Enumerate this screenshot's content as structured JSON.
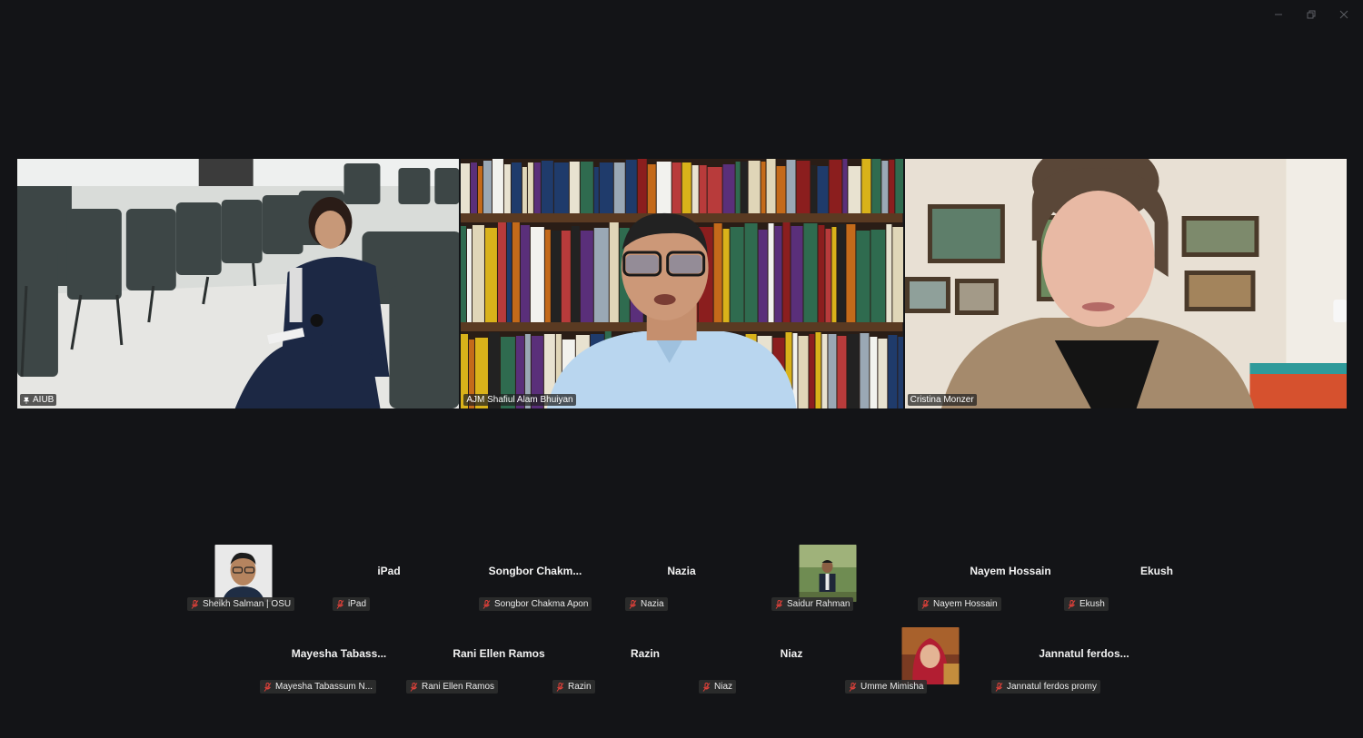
{
  "window": {
    "controls": {
      "minimize": "minimize-icon",
      "restore": "restore-icon",
      "close": "close-icon"
    }
  },
  "videos": [
    {
      "name": "AIUB",
      "active": true,
      "pinned": true
    },
    {
      "name": "AJM Shafiul Alam Bhuiyan",
      "active": false,
      "pinned": false
    },
    {
      "name": "Cristina Monzer",
      "active": false,
      "pinned": false
    }
  ],
  "participants": {
    "row1": [
      {
        "display": "",
        "label": "Sheikh Salman | OSU",
        "has_avatar": true,
        "muted": true
      },
      {
        "display": "iPad",
        "label": "iPad",
        "has_avatar": false,
        "muted": true
      },
      {
        "display": "Songbor  Chakm...",
        "label": "Songbor Chakma Apon",
        "has_avatar": false,
        "muted": true
      },
      {
        "display": "Nazia",
        "label": "Nazia",
        "has_avatar": false,
        "muted": true
      },
      {
        "display": "",
        "label": "Saidur Rahman",
        "has_avatar": true,
        "muted": true
      },
      {
        "display": "Nayem Hossain",
        "label": "Nayem Hossain",
        "has_avatar": false,
        "muted": true
      },
      {
        "display": "Ekush",
        "label": "Ekush",
        "has_avatar": false,
        "muted": true
      }
    ],
    "row2": [
      {
        "display": "Mayesha  Tabass...",
        "label": "Mayesha Tabassum N...",
        "has_avatar": false,
        "muted": true
      },
      {
        "display": "Rani Ellen Ramos",
        "label": "Rani Ellen Ramos",
        "has_avatar": false,
        "muted": true
      },
      {
        "display": "Razin",
        "label": "Razin",
        "has_avatar": false,
        "muted": true
      },
      {
        "display": "Niaz",
        "label": "Niaz",
        "has_avatar": false,
        "muted": true
      },
      {
        "display": "",
        "label": "Umme Mimisha",
        "has_avatar": true,
        "muted": true
      },
      {
        "display": "Jannatul  ferdos...",
        "label": "Jannatul ferdos promy",
        "has_avatar": false,
        "muted": true
      }
    ]
  },
  "colors": {
    "background": "#131417",
    "active_speaker": "#3fd17a",
    "mic_off": "#e0413a"
  }
}
